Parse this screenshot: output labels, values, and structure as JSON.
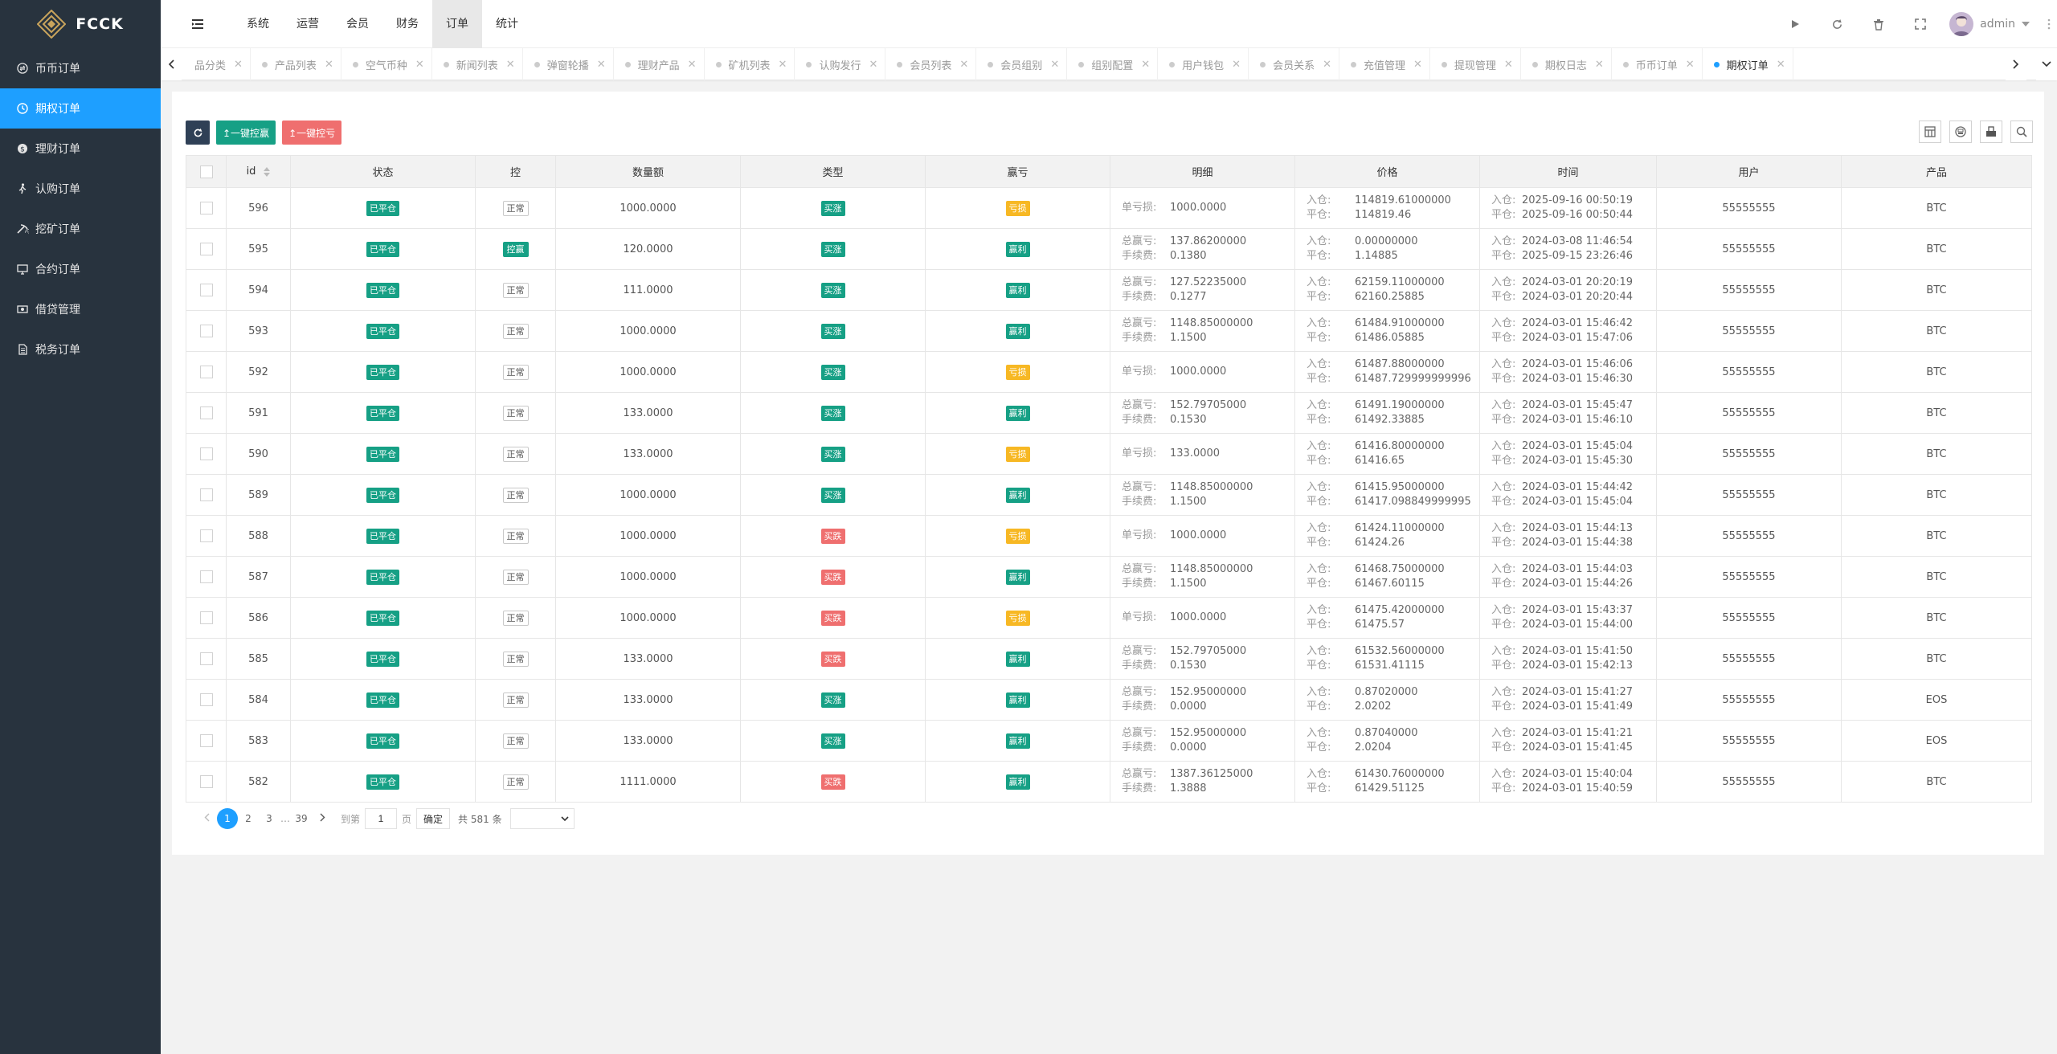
{
  "brand": {
    "name": "FCCK"
  },
  "sidebar": {
    "items": [
      {
        "label": "币币订单",
        "icon": "exchange-icon",
        "active": false
      },
      {
        "label": "期权订单",
        "icon": "clock-icon",
        "active": true
      },
      {
        "label": "理财订单",
        "icon": "coin-icon",
        "active": false
      },
      {
        "label": "认购订单",
        "icon": "walker-icon",
        "active": false
      },
      {
        "label": "挖矿订单",
        "icon": "pickaxe-icon",
        "active": false
      },
      {
        "label": "合约订单",
        "icon": "monitor-icon",
        "active": false
      },
      {
        "label": "借贷管理",
        "icon": "money-icon",
        "active": false
      },
      {
        "label": "税务订单",
        "icon": "document-icon",
        "active": false
      }
    ]
  },
  "header": {
    "nav": [
      {
        "label": "系统"
      },
      {
        "label": "运营"
      },
      {
        "label": "会员"
      },
      {
        "label": "财务"
      },
      {
        "label": "订单",
        "active": true
      },
      {
        "label": "统计"
      }
    ],
    "user": "admin"
  },
  "tabs": [
    {
      "label": "品分类"
    },
    {
      "label": "产品列表"
    },
    {
      "label": "空气币种"
    },
    {
      "label": "新闻列表"
    },
    {
      "label": "弹窗轮播"
    },
    {
      "label": "理财产品"
    },
    {
      "label": "矿机列表"
    },
    {
      "label": "认购发行"
    },
    {
      "label": "会员列表"
    },
    {
      "label": "会员组别"
    },
    {
      "label": "组别配置"
    },
    {
      "label": "用户钱包"
    },
    {
      "label": "会员关系"
    },
    {
      "label": "充值管理"
    },
    {
      "label": "提现管理"
    },
    {
      "label": "期权日志"
    },
    {
      "label": "币币订单"
    },
    {
      "label": "期权订单",
      "active": true
    }
  ],
  "toolbar": {
    "win_label": "↥一键控赢",
    "lose_label": "↥一键控亏"
  },
  "table": {
    "columns": [
      "id",
      "状态",
      "控",
      "数量额",
      "类型",
      "赢亏",
      "明细",
      "价格",
      "时间",
      "用户",
      "产品"
    ],
    "rows": [
      {
        "id": "596",
        "status": "已平仓",
        "ctrl": "正常",
        "ctrl_win": false,
        "amount": "1000.0000",
        "type": "买涨",
        "type_up": true,
        "pl": "亏损",
        "pl_win": false,
        "d1k": "单亏损:",
        "d1v": "1000.0000",
        "d2k": "",
        "d2v": "",
        "p_in": "114819.61000000",
        "p_out": "114819.46",
        "t_in": "2025-09-16 00:50:19",
        "t_out": "2025-09-16 00:50:44",
        "user": "55555555",
        "product": "BTC"
      },
      {
        "id": "595",
        "status": "已平仓",
        "ctrl": "控赢",
        "ctrl_win": true,
        "amount": "120.0000",
        "type": "买涨",
        "type_up": true,
        "pl": "赢利",
        "pl_win": true,
        "d1k": "总赢亏:",
        "d1v": "137.86200000",
        "d2k": "手续费:",
        "d2v": "0.1380",
        "p_in": "0.00000000",
        "p_out": "1.14885",
        "t_in": "2024-03-08 11:46:54",
        "t_out": "2025-09-15 23:26:46",
        "user": "55555555",
        "product": "BTC"
      },
      {
        "id": "594",
        "status": "已平仓",
        "ctrl": "正常",
        "ctrl_win": false,
        "amount": "111.0000",
        "type": "买涨",
        "type_up": true,
        "pl": "赢利",
        "pl_win": true,
        "d1k": "总赢亏:",
        "d1v": "127.52235000",
        "d2k": "手续费:",
        "d2v": "0.1277",
        "p_in": "62159.11000000",
        "p_out": "62160.25885",
        "t_in": "2024-03-01 20:20:19",
        "t_out": "2024-03-01 20:20:44",
        "user": "55555555",
        "product": "BTC"
      },
      {
        "id": "593",
        "status": "已平仓",
        "ctrl": "正常",
        "ctrl_win": false,
        "amount": "1000.0000",
        "type": "买涨",
        "type_up": true,
        "pl": "赢利",
        "pl_win": true,
        "d1k": "总赢亏:",
        "d1v": "1148.85000000",
        "d2k": "手续费:",
        "d2v": "1.1500",
        "p_in": "61484.91000000",
        "p_out": "61486.05885",
        "t_in": "2024-03-01 15:46:42",
        "t_out": "2024-03-01 15:47:06",
        "user": "55555555",
        "product": "BTC"
      },
      {
        "id": "592",
        "status": "已平仓",
        "ctrl": "正常",
        "ctrl_win": false,
        "amount": "1000.0000",
        "type": "买涨",
        "type_up": true,
        "pl": "亏损",
        "pl_win": false,
        "d1k": "单亏损:",
        "d1v": "1000.0000",
        "d2k": "",
        "d2v": "",
        "p_in": "61487.88000000",
        "p_out": "61487.729999999996",
        "t_in": "2024-03-01 15:46:06",
        "t_out": "2024-03-01 15:46:30",
        "user": "55555555",
        "product": "BTC"
      },
      {
        "id": "591",
        "status": "已平仓",
        "ctrl": "正常",
        "ctrl_win": false,
        "amount": "133.0000",
        "type": "买涨",
        "type_up": true,
        "pl": "赢利",
        "pl_win": true,
        "d1k": "总赢亏:",
        "d1v": "152.79705000",
        "d2k": "手续费:",
        "d2v": "0.1530",
        "p_in": "61491.19000000",
        "p_out": "61492.33885",
        "t_in": "2024-03-01 15:45:47",
        "t_out": "2024-03-01 15:46:10",
        "user": "55555555",
        "product": "BTC"
      },
      {
        "id": "590",
        "status": "已平仓",
        "ctrl": "正常",
        "ctrl_win": false,
        "amount": "133.0000",
        "type": "买涨",
        "type_up": true,
        "pl": "亏损",
        "pl_win": false,
        "d1k": "单亏损:",
        "d1v": "133.0000",
        "d2k": "",
        "d2v": "",
        "p_in": "61416.80000000",
        "p_out": "61416.65",
        "t_in": "2024-03-01 15:45:04",
        "t_out": "2024-03-01 15:45:30",
        "user": "55555555",
        "product": "BTC"
      },
      {
        "id": "589",
        "status": "已平仓",
        "ctrl": "正常",
        "ctrl_win": false,
        "amount": "1000.0000",
        "type": "买涨",
        "type_up": true,
        "pl": "赢利",
        "pl_win": true,
        "d1k": "总赢亏:",
        "d1v": "1148.85000000",
        "d2k": "手续费:",
        "d2v": "1.1500",
        "p_in": "61415.95000000",
        "p_out": "61417.098849999995",
        "t_in": "2024-03-01 15:44:42",
        "t_out": "2024-03-01 15:45:04",
        "user": "55555555",
        "product": "BTC"
      },
      {
        "id": "588",
        "status": "已平仓",
        "ctrl": "正常",
        "ctrl_win": false,
        "amount": "1000.0000",
        "type": "买跌",
        "type_up": false,
        "pl": "亏损",
        "pl_win": false,
        "d1k": "单亏损:",
        "d1v": "1000.0000",
        "d2k": "",
        "d2v": "",
        "p_in": "61424.11000000",
        "p_out": "61424.26",
        "t_in": "2024-03-01 15:44:13",
        "t_out": "2024-03-01 15:44:38",
        "user": "55555555",
        "product": "BTC"
      },
      {
        "id": "587",
        "status": "已平仓",
        "ctrl": "正常",
        "ctrl_win": false,
        "amount": "1000.0000",
        "type": "买跌",
        "type_up": false,
        "pl": "赢利",
        "pl_win": true,
        "d1k": "总赢亏:",
        "d1v": "1148.85000000",
        "d2k": "手续费:",
        "d2v": "1.1500",
        "p_in": "61468.75000000",
        "p_out": "61467.60115",
        "t_in": "2024-03-01 15:44:03",
        "t_out": "2024-03-01 15:44:26",
        "user": "55555555",
        "product": "BTC"
      },
      {
        "id": "586",
        "status": "已平仓",
        "ctrl": "正常",
        "ctrl_win": false,
        "amount": "1000.0000",
        "type": "买跌",
        "type_up": false,
        "pl": "亏损",
        "pl_win": false,
        "d1k": "单亏损:",
        "d1v": "1000.0000",
        "d2k": "",
        "d2v": "",
        "p_in": "61475.42000000",
        "p_out": "61475.57",
        "t_in": "2024-03-01 15:43:37",
        "t_out": "2024-03-01 15:44:00",
        "user": "55555555",
        "product": "BTC"
      },
      {
        "id": "585",
        "status": "已平仓",
        "ctrl": "正常",
        "ctrl_win": false,
        "amount": "133.0000",
        "type": "买跌",
        "type_up": false,
        "pl": "赢利",
        "pl_win": true,
        "d1k": "总赢亏:",
        "d1v": "152.79705000",
        "d2k": "手续费:",
        "d2v": "0.1530",
        "p_in": "61532.56000000",
        "p_out": "61531.41115",
        "t_in": "2024-03-01 15:41:50",
        "t_out": "2024-03-01 15:42:13",
        "user": "55555555",
        "product": "BTC"
      },
      {
        "id": "584",
        "status": "已平仓",
        "ctrl": "正常",
        "ctrl_win": false,
        "amount": "133.0000",
        "type": "买涨",
        "type_up": true,
        "pl": "赢利",
        "pl_win": true,
        "d1k": "总赢亏:",
        "d1v": "152.95000000",
        "d2k": "手续费:",
        "d2v": "0.0000",
        "p_in": "0.87020000",
        "p_out": "2.0202",
        "t_in": "2024-03-01 15:41:27",
        "t_out": "2024-03-01 15:41:49",
        "user": "55555555",
        "product": "EOS"
      },
      {
        "id": "583",
        "status": "已平仓",
        "ctrl": "正常",
        "ctrl_win": false,
        "amount": "133.0000",
        "type": "买涨",
        "type_up": true,
        "pl": "赢利",
        "pl_win": true,
        "d1k": "总赢亏:",
        "d1v": "152.95000000",
        "d2k": "手续费:",
        "d2v": "0.0000",
        "p_in": "0.87040000",
        "p_out": "2.0204",
        "t_in": "2024-03-01 15:41:21",
        "t_out": "2024-03-01 15:41:45",
        "user": "55555555",
        "product": "EOS"
      },
      {
        "id": "582",
        "status": "已平仓",
        "ctrl": "正常",
        "ctrl_win": false,
        "amount": "1111.0000",
        "type": "买跌",
        "type_up": false,
        "pl": "赢利",
        "pl_win": true,
        "d1k": "总赢亏:",
        "d1v": "1387.36125000",
        "d2k": "手续费:",
        "d2v": "1.3888",
        "p_in": "61430.76000000",
        "p_out": "61429.51125",
        "t_in": "2024-03-01 15:40:04",
        "t_out": "2024-03-01 15:40:59",
        "user": "55555555",
        "product": "BTC"
      }
    ],
    "labels": {
      "in": "入仓:",
      "out": "平仓:"
    }
  },
  "pager": {
    "pages": [
      "1",
      "2",
      "3"
    ],
    "ellipsis": "…",
    "last": "39",
    "goto_label": "到第",
    "page_value": "1",
    "page_unit": "页",
    "confirm": "确定",
    "total": "共 581 条"
  },
  "colors": {
    "sidebar_bg": "#28333e",
    "active_blue": "#1e9fff",
    "green": "#16a085",
    "red": "#ef6f6f",
    "orange": "#f7b824"
  }
}
